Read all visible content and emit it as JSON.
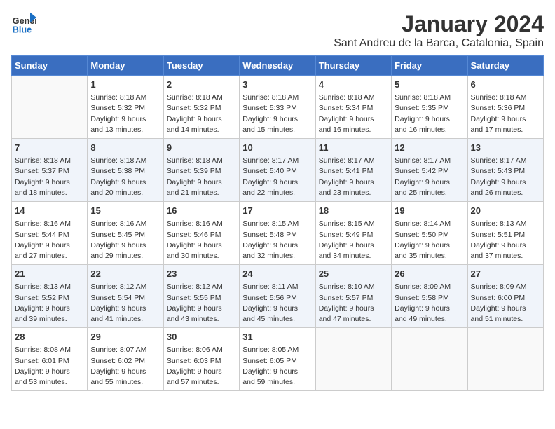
{
  "header": {
    "logo_line1": "General",
    "logo_line2": "Blue",
    "title": "January 2024",
    "subtitle": "Sant Andreu de la Barca, Catalonia, Spain"
  },
  "days_of_week": [
    "Sunday",
    "Monday",
    "Tuesday",
    "Wednesday",
    "Thursday",
    "Friday",
    "Saturday"
  ],
  "weeks": [
    [
      {
        "num": "",
        "info": ""
      },
      {
        "num": "1",
        "info": "Sunrise: 8:18 AM\nSunset: 5:32 PM\nDaylight: 9 hours\nand 13 minutes."
      },
      {
        "num": "2",
        "info": "Sunrise: 8:18 AM\nSunset: 5:32 PM\nDaylight: 9 hours\nand 14 minutes."
      },
      {
        "num": "3",
        "info": "Sunrise: 8:18 AM\nSunset: 5:33 PM\nDaylight: 9 hours\nand 15 minutes."
      },
      {
        "num": "4",
        "info": "Sunrise: 8:18 AM\nSunset: 5:34 PM\nDaylight: 9 hours\nand 16 minutes."
      },
      {
        "num": "5",
        "info": "Sunrise: 8:18 AM\nSunset: 5:35 PM\nDaylight: 9 hours\nand 16 minutes."
      },
      {
        "num": "6",
        "info": "Sunrise: 8:18 AM\nSunset: 5:36 PM\nDaylight: 9 hours\nand 17 minutes."
      }
    ],
    [
      {
        "num": "7",
        "info": "Sunrise: 8:18 AM\nSunset: 5:37 PM\nDaylight: 9 hours\nand 18 minutes."
      },
      {
        "num": "8",
        "info": "Sunrise: 8:18 AM\nSunset: 5:38 PM\nDaylight: 9 hours\nand 20 minutes."
      },
      {
        "num": "9",
        "info": "Sunrise: 8:18 AM\nSunset: 5:39 PM\nDaylight: 9 hours\nand 21 minutes."
      },
      {
        "num": "10",
        "info": "Sunrise: 8:17 AM\nSunset: 5:40 PM\nDaylight: 9 hours\nand 22 minutes."
      },
      {
        "num": "11",
        "info": "Sunrise: 8:17 AM\nSunset: 5:41 PM\nDaylight: 9 hours\nand 23 minutes."
      },
      {
        "num": "12",
        "info": "Sunrise: 8:17 AM\nSunset: 5:42 PM\nDaylight: 9 hours\nand 25 minutes."
      },
      {
        "num": "13",
        "info": "Sunrise: 8:17 AM\nSunset: 5:43 PM\nDaylight: 9 hours\nand 26 minutes."
      }
    ],
    [
      {
        "num": "14",
        "info": "Sunrise: 8:16 AM\nSunset: 5:44 PM\nDaylight: 9 hours\nand 27 minutes."
      },
      {
        "num": "15",
        "info": "Sunrise: 8:16 AM\nSunset: 5:45 PM\nDaylight: 9 hours\nand 29 minutes."
      },
      {
        "num": "16",
        "info": "Sunrise: 8:16 AM\nSunset: 5:46 PM\nDaylight: 9 hours\nand 30 minutes."
      },
      {
        "num": "17",
        "info": "Sunrise: 8:15 AM\nSunset: 5:48 PM\nDaylight: 9 hours\nand 32 minutes."
      },
      {
        "num": "18",
        "info": "Sunrise: 8:15 AM\nSunset: 5:49 PM\nDaylight: 9 hours\nand 34 minutes."
      },
      {
        "num": "19",
        "info": "Sunrise: 8:14 AM\nSunset: 5:50 PM\nDaylight: 9 hours\nand 35 minutes."
      },
      {
        "num": "20",
        "info": "Sunrise: 8:13 AM\nSunset: 5:51 PM\nDaylight: 9 hours\nand 37 minutes."
      }
    ],
    [
      {
        "num": "21",
        "info": "Sunrise: 8:13 AM\nSunset: 5:52 PM\nDaylight: 9 hours\nand 39 minutes."
      },
      {
        "num": "22",
        "info": "Sunrise: 8:12 AM\nSunset: 5:54 PM\nDaylight: 9 hours\nand 41 minutes."
      },
      {
        "num": "23",
        "info": "Sunrise: 8:12 AM\nSunset: 5:55 PM\nDaylight: 9 hours\nand 43 minutes."
      },
      {
        "num": "24",
        "info": "Sunrise: 8:11 AM\nSunset: 5:56 PM\nDaylight: 9 hours\nand 45 minutes."
      },
      {
        "num": "25",
        "info": "Sunrise: 8:10 AM\nSunset: 5:57 PM\nDaylight: 9 hours\nand 47 minutes."
      },
      {
        "num": "26",
        "info": "Sunrise: 8:09 AM\nSunset: 5:58 PM\nDaylight: 9 hours\nand 49 minutes."
      },
      {
        "num": "27",
        "info": "Sunrise: 8:09 AM\nSunset: 6:00 PM\nDaylight: 9 hours\nand 51 minutes."
      }
    ],
    [
      {
        "num": "28",
        "info": "Sunrise: 8:08 AM\nSunset: 6:01 PM\nDaylight: 9 hours\nand 53 minutes."
      },
      {
        "num": "29",
        "info": "Sunrise: 8:07 AM\nSunset: 6:02 PM\nDaylight: 9 hours\nand 55 minutes."
      },
      {
        "num": "30",
        "info": "Sunrise: 8:06 AM\nSunset: 6:03 PM\nDaylight: 9 hours\nand 57 minutes."
      },
      {
        "num": "31",
        "info": "Sunrise: 8:05 AM\nSunset: 6:05 PM\nDaylight: 9 hours\nand 59 minutes."
      },
      {
        "num": "",
        "info": ""
      },
      {
        "num": "",
        "info": ""
      },
      {
        "num": "",
        "info": ""
      }
    ]
  ]
}
